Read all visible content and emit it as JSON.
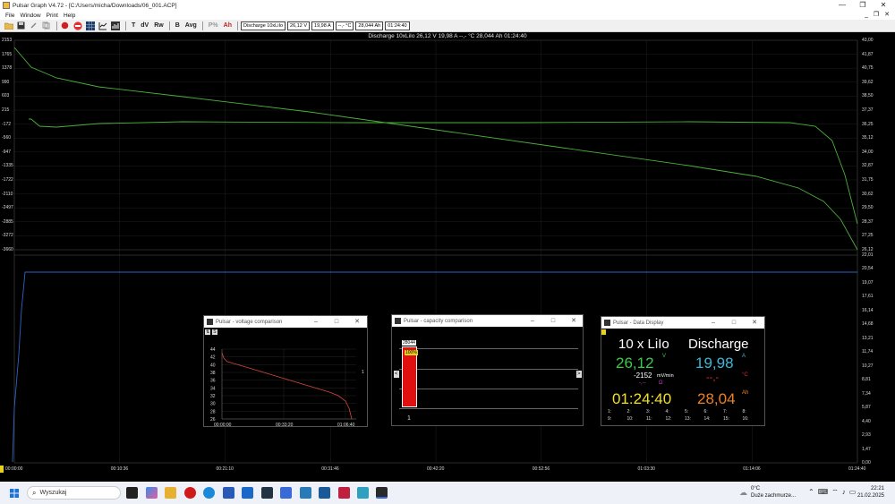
{
  "app": {
    "title": "Pulsar Graph V4.72 - [C:/Users/micha/Downloads/06_001.ACP]",
    "window_controls": [
      "—",
      "❐",
      "✕"
    ]
  },
  "menu": [
    "File",
    "Window",
    "Print",
    "Help"
  ],
  "mdi_controls": "_ ❐ ✕",
  "toolbar": {
    "text_buttons": [
      "T",
      "dV",
      "Rw",
      "B",
      "Avg",
      "P%",
      "Ah"
    ],
    "boxes": [
      "Discharge 10xLiIo",
      "26,12 V",
      "19,98 A",
      "--,- °C",
      "28,044 Ah",
      "01:24:40"
    ]
  },
  "status_line": "Discharge 10xLiIo   26,12 V   19,98 A   --,- °C   28,044 Ah   01:24:40",
  "chart": {
    "left_ticks": [
      "2153",
      "1765",
      "1378",
      "990",
      "603",
      "215",
      "-172",
      "-560",
      "-947",
      "-1335",
      "-1722",
      "-2110",
      "-2497",
      "-2885",
      "-3272",
      "-3660"
    ],
    "right_ticks": [
      "43,00",
      "41,87",
      "40,75",
      "39,62",
      "38,50",
      "37,37",
      "36,25",
      "35,12",
      "34,00",
      "32,87",
      "31,75",
      "30,62",
      "29,50",
      "28,37",
      "27,25",
      "26,12",
      "22,01",
      "20,54",
      "19,07",
      "17,61",
      "16,14",
      "14,68",
      "13,21",
      "11,74",
      "10,27",
      "8,81",
      "7,34",
      "5,87",
      "4,40",
      "2,93",
      "1,47",
      "0,00"
    ],
    "x_ticks": [
      "00:00:00",
      "00:10:36",
      "00:21:10",
      "00:31:46",
      "00:42:20",
      "00:52:56",
      "01:03:30",
      "01:14:06",
      "01:24:40"
    ],
    "voltage_color": "#4caf3c",
    "current_color": "#2f62c8"
  },
  "voltage_window": {
    "title": "Pulsar - voltage comparison",
    "tools": [
      "⇅",
      "S"
    ],
    "y_ticks": [
      "44",
      "42",
      "40",
      "38",
      "36",
      "34",
      "32",
      "30",
      "28",
      "26"
    ],
    "x_ticks": [
      "00:00:00",
      "00:33:20",
      "01:06:40"
    ],
    "marker": "1",
    "line_color": "#d2493a"
  },
  "capacity_window": {
    "title": "Pulsar - capacity comparison",
    "bar_value": "28044",
    "bar_percent": "100%",
    "bar_fill": 1.0,
    "bar_label": "1",
    "bar_color": "#e01010",
    "nav_left": "<",
    "nav_right": ">"
  },
  "data_window": {
    "title": "Pulsar - Data Display",
    "cells": "10 x LiIo",
    "mode": "Discharge",
    "voltage": "26,12",
    "voltage_unit": "V",
    "current": "19,98",
    "current_unit": "A",
    "slope": "-2152",
    "slope_unit": "mV/min",
    "small_left": "-,--",
    "small_mid": "Ω",
    "temp": "--,-",
    "temp_unit": "°C",
    "time": "01:24:40",
    "capacity": "28,04",
    "capacity_unit": "Ah",
    "channels_row1": [
      "1:",
      "2:",
      "3:",
      "4:",
      "5:",
      "6:",
      "7:",
      "8:"
    ],
    "channels_row2": [
      "9:",
      "10:",
      "11:",
      "12:",
      "13:",
      "14:",
      "15:",
      "16:"
    ]
  },
  "taskbar": {
    "search_placeholder": "Wyszukaj",
    "weather_temp": "0°C",
    "weather_desc": "Duże zachmurze...",
    "time": "22:21",
    "date": "21.02.2025"
  }
}
